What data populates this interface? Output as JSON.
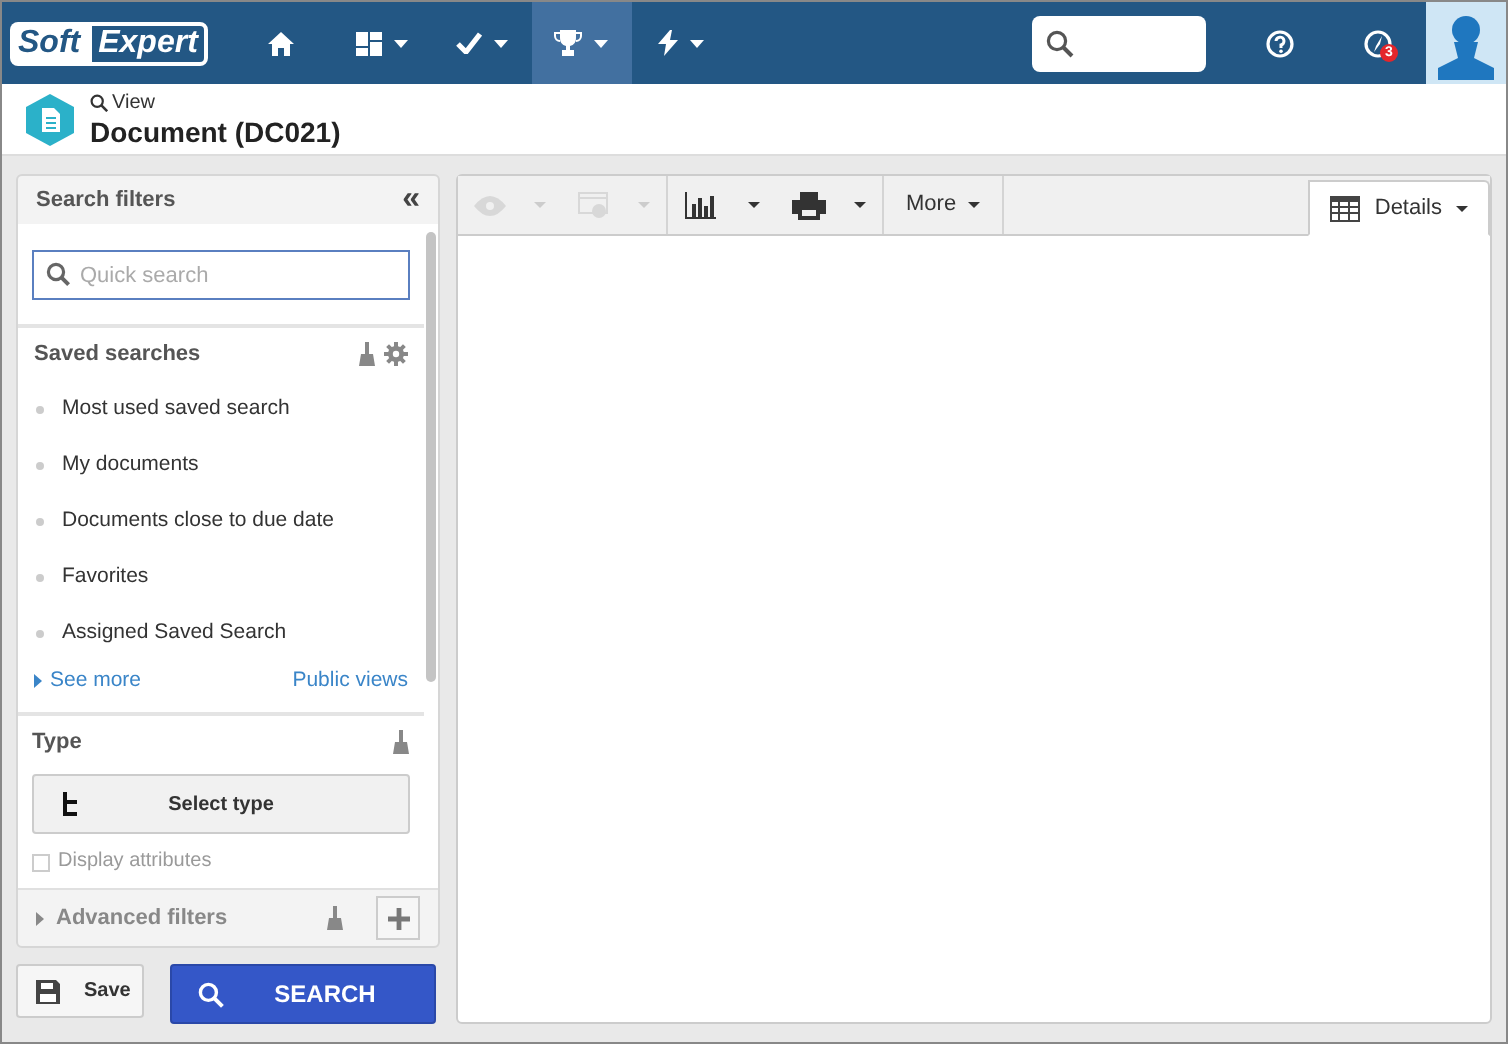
{
  "topbar": {
    "logo": [
      "Soft",
      "Expert"
    ],
    "nav": [
      {
        "kind": "home",
        "caret": false,
        "selected": false
      },
      {
        "kind": "dashboard",
        "caret": true,
        "selected": false
      },
      {
        "kind": "check",
        "caret": true,
        "selected": false
      },
      {
        "kind": "trophy",
        "caret": true,
        "selected": true
      },
      {
        "kind": "bolt",
        "caret": true,
        "selected": false
      }
    ],
    "notification_count": "3"
  },
  "header": {
    "mode": "View",
    "title": "Document (DC021)"
  },
  "filters": {
    "title": "Search filters",
    "collapse": "«",
    "quick_search": {
      "placeholder": "Quick search"
    },
    "saved_searches": {
      "title": "Saved searches",
      "items": [
        "Most used saved search",
        "My documents",
        "Documents close to due date",
        "Favorites",
        "Assigned Saved Search"
      ],
      "see_more": "See more",
      "public_views": "Public views"
    },
    "type": {
      "title": "Type",
      "button": "Select type"
    },
    "display_attributes": {
      "label": "Display attributes",
      "checked": false,
      "disabled": true
    },
    "advanced": {
      "title": "Advanced filters",
      "expanded": false
    }
  },
  "actions": {
    "save": "Save",
    "search": "SEARCH"
  },
  "toolbar": {
    "buttons": [
      {
        "kind": "eye",
        "disabled": true,
        "caret": true
      },
      {
        "kind": "preview",
        "disabled": true,
        "caret": true
      },
      {
        "kind": "chart",
        "disabled": false,
        "caret": true
      },
      {
        "kind": "print",
        "disabled": false,
        "caret": true
      }
    ],
    "more": "More",
    "view_tab": "Details"
  }
}
